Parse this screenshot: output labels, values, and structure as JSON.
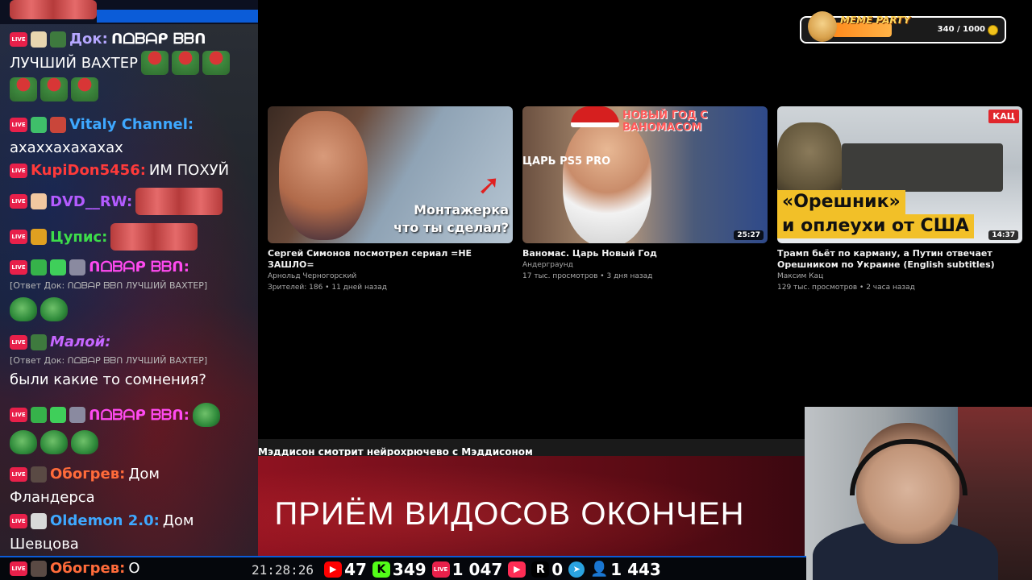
{
  "chat": {
    "messages": [
      {
        "user": "Док:",
        "user_color": "#b5a7ff",
        "text": "ᑎᗝᗷᗩᑭ ᗷᗷᑎ",
        "text2": "ЛУЧШИЙ ВАХТЕР"
      },
      {
        "user": "Vitaly Channel:",
        "user_color": "#3ea8ff",
        "text": "ахаххахахахах"
      },
      {
        "user": "KupiDon5456:",
        "user_color": "#ff3a3a",
        "text": "ИМ ПОХУЙ"
      },
      {
        "user": "DVD__RW:",
        "user_color": "#b35bff",
        "text": ""
      },
      {
        "user": "Цупис:",
        "user_color": "#3ddc4a",
        "text": ""
      },
      {
        "user": "ᑎᗝᗷᗩᑭ ᗷᗷᑎ:",
        "user_color": "#ff4af0",
        "text": ""
      },
      {
        "reply": "[Ответ Док: ᑎᗝᗷᗩᑭ ᗷᗷᑎ ЛУЧШИЙ ВАХТЕР]"
      },
      {
        "user": "Малой:",
        "user_color": "#c566ff",
        "text": ""
      },
      {
        "reply": "[Ответ Док: ᑎᗝᗷᗩᑭ ᗷᗷᑎ ЛУЧШИЙ ВАХТЕР]",
        "text": "были какие то сомнения?"
      },
      {
        "user": "ᑎᗝᗷᗩᑭ ᗷᗷᑎ:",
        "user_color": "#ff4af0",
        "text": ""
      },
      {
        "user": "Обогрев:",
        "user_color": "#ff6b3a",
        "text": "Дом",
        "text2": "Фландерса"
      },
      {
        "user": "Oldemon 2.0:",
        "user_color": "#3ea8ff",
        "text": "Дом",
        "text2": "Шевцова"
      }
    ],
    "live_badge": "LIVE"
  },
  "meme_party": {
    "title": "MEME PARTY",
    "count": "340 / 1000",
    "progress": 0.34
  },
  "videos": [
    {
      "title": "Сергей Симонов посмотрел сериал =НЕ ЗАШЛО=",
      "channel": "Арнольд Черногорский",
      "meta": "Зрителей: 186 • 11 дней назад",
      "overlay": "Монтажерка что ты сделал?",
      "duration": ""
    },
    {
      "title": "Ваномас. Царь Новый Год",
      "channel": "Андерграунд",
      "meta": "17 тыс. просмотров • 3 дня назад",
      "caption_top": "НОВЫЙ ГОД С ВАНОМАСОМ",
      "caption_side": "ЦАРЬ PS5 PRO",
      "duration": "25:27"
    },
    {
      "title": "Трамп бьёт по карману, а Путин отвечает Орешником по Украине (English subtitles)",
      "channel": "Максим Кац",
      "meta": "129 тыс. просмотров • 2 часа назад",
      "badge": "КАЦ",
      "banner_line1": "«Орешник»",
      "banner_line2": "и оплеухи от США",
      "duration": "14:37"
    }
  ],
  "ticker": "Мэддисон смотрит нейрохрючево с Мэддисоном",
  "banner_text": "ПРИЁМ ВИДОСОВ ОКОНЧЕН",
  "status": {
    "last_user": "Обогрев:",
    "last_text": "О",
    "clock": "21:28:26",
    "youtube": "47",
    "kick": "349",
    "vk_live": "1 047",
    "vk_play": "",
    "rutube": "0",
    "telegram": "",
    "viewers": "1 443"
  }
}
